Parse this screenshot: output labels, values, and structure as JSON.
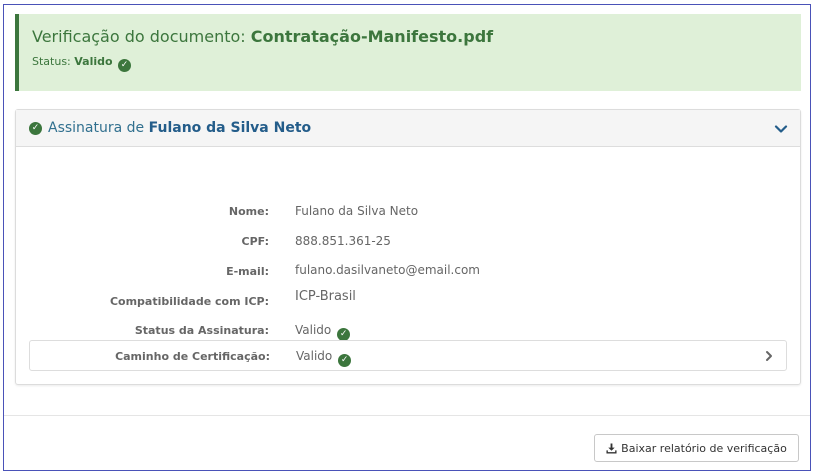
{
  "banner": {
    "title_prefix": "Verificação do documento:",
    "document_name": "Contratação-Manifesto.pdf",
    "status_label": "Status:",
    "status_value": "Valido"
  },
  "signature_panel": {
    "title_prefix": "Assinatura de",
    "signer_name": "Fulano da Silva Neto",
    "rows": [
      {
        "label": "Nome:",
        "value": "Fulano da Silva Neto"
      },
      {
        "label": "CPF:",
        "value": "888.851.361-25"
      },
      {
        "label": "E-mail:",
        "value": "fulano.dasilvaneto@email.com"
      },
      {
        "label": "Compatibilidade com ICP:",
        "value": "ICP-Brasil"
      },
      {
        "label": "Status da Assinatura:",
        "value": "Valido"
      },
      {
        "label": "Caminho de Certificação:",
        "value": "Valido"
      }
    ]
  },
  "footer": {
    "download_label": "Baixar relatório de verificação"
  },
  "colors": {
    "success": "#3c763d",
    "success_bg": "#dff0d8",
    "panel_title": "#31708f",
    "frame_border": "#4a52b8"
  },
  "icons": [
    "check-circle-icon",
    "chevron-down-icon",
    "chevron-right-icon",
    "download-icon"
  ]
}
